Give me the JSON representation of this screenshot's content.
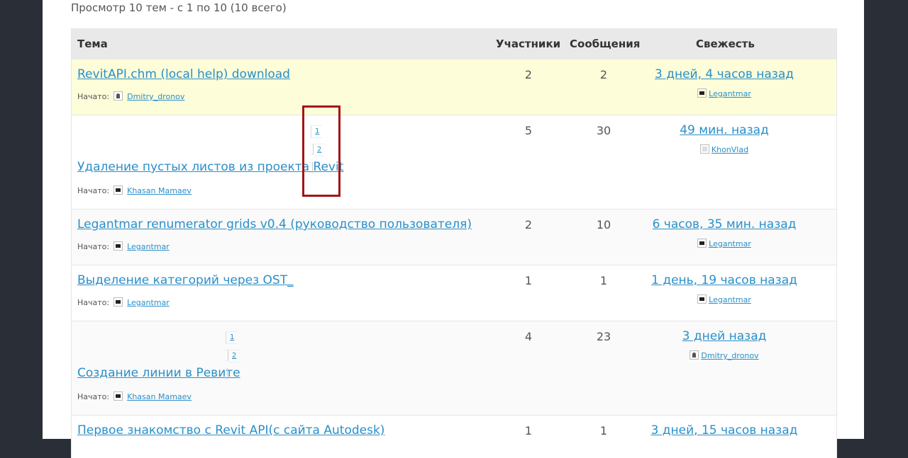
{
  "summary": "Просмотр 10 тем - с 1 по 10 (10 всего)",
  "header": {
    "topic": "Тема",
    "participants": "Участники",
    "messages": "Сообщения",
    "freshness": "Свежесть"
  },
  "started_label": "Начато:",
  "rows": [
    {
      "title": "RevitAPI.chm (local help) download",
      "author": "Dmitry_dronov",
      "participants": "2",
      "messages": "2",
      "fresh": "3 дней, 4 часов назад",
      "last": "Legantmar"
    },
    {
      "title": "Удаление пустых листов из проекта Revit",
      "author": "Khasan Mamaev",
      "participants": "5",
      "messages": "30",
      "fresh": "49 мин. назад",
      "last": "KhonVlad",
      "pages": [
        "1",
        "2"
      ]
    },
    {
      "title": "Legantmar renumerator grids v0.4 (руководство пользователя)",
      "author": "Legantmar",
      "participants": "2",
      "messages": "10",
      "fresh": "6 часов, 35 мин. назад",
      "last": "Legantmar"
    },
    {
      "title": "Выделение категорий через OST_",
      "author": "Legantmar",
      "participants": "1",
      "messages": "1",
      "fresh": "1 день, 19 часов назад",
      "last": "Legantmar"
    },
    {
      "title": "Создание линии в Ревите",
      "author": "Khasan Mamaev",
      "participants": "4",
      "messages": "23",
      "fresh": "3 дней назад",
      "last": "Dmitry_dronov",
      "pages": [
        "1",
        "2"
      ]
    },
    {
      "title": "Первое знакомство с Revit API(с сайта Autodesk)",
      "participants": "1",
      "messages": "1",
      "fresh": "3 дней, 15 часов назад"
    }
  ],
  "colors": {
    "link": "#2a8fc9",
    "sticky_bg": "#fdfdd9",
    "highlight_box": "#a31515",
    "frame": "#2a2e37"
  }
}
